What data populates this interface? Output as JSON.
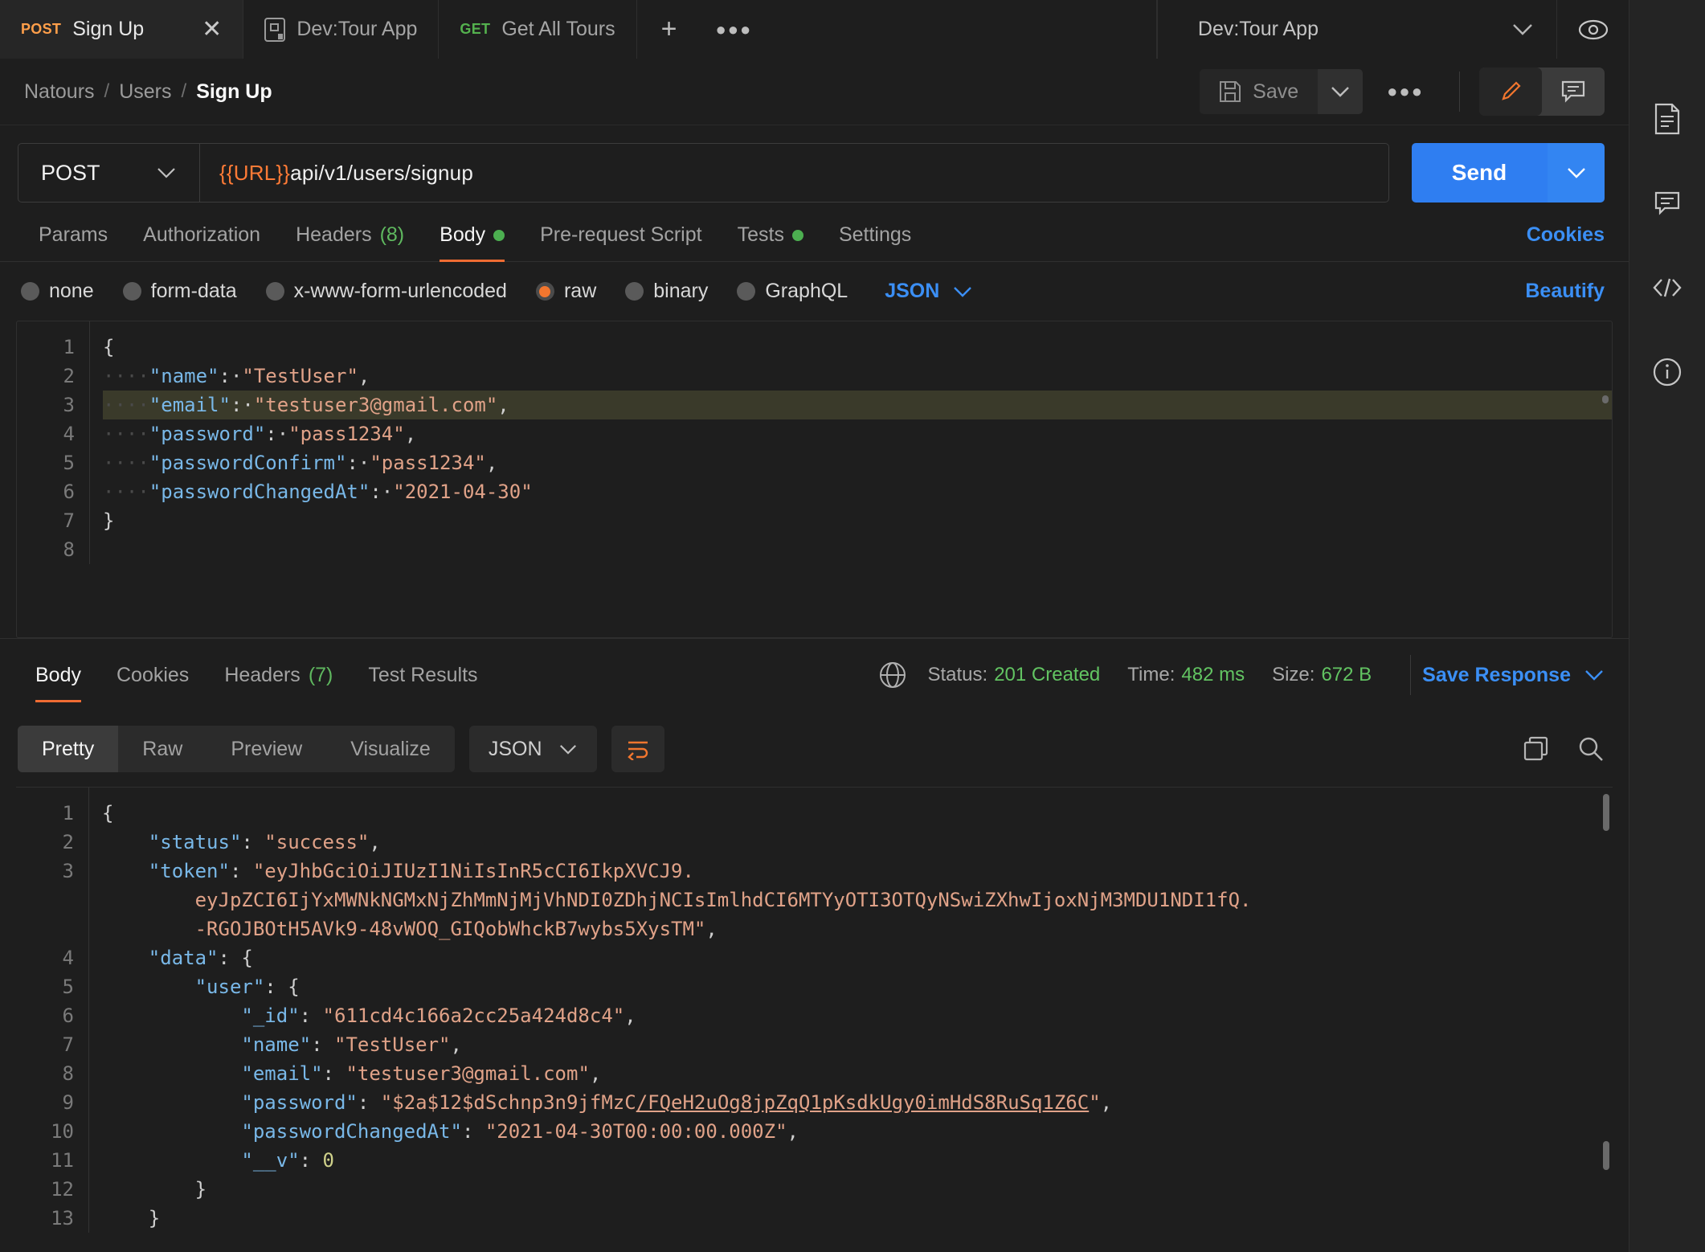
{
  "tabs": [
    {
      "verb": "POST",
      "verb_class": "post",
      "label": "Sign Up",
      "active": true,
      "close": "✕"
    },
    {
      "verb": "",
      "verb_class": "",
      "label": "Dev:Tour App",
      "active": false,
      "close": ""
    },
    {
      "verb": "GET",
      "verb_class": "get",
      "label": "Get All Tours",
      "active": false,
      "close": ""
    }
  ],
  "tabbar": {
    "new_tab": "+",
    "more": "●●●"
  },
  "environment": {
    "name": "Dev:Tour App",
    "chevron": "⌄",
    "eye_icon": "eye-icon"
  },
  "breadcrumb": {
    "collection": "Natours",
    "folder": "Users",
    "request": "Sign Up",
    "separator": "/"
  },
  "actions": {
    "save_label": "Save",
    "save_chevron": "⌄",
    "more_label": "●●●",
    "edit_icon": "pencil-icon",
    "comment_icon": "comment-icon"
  },
  "request": {
    "method": "POST",
    "method_chevron": "⌄",
    "url_variable": "{{URL}}",
    "url_path": "api/v1/users/signup",
    "send_label": "Send",
    "send_chevron": "⌄",
    "tabs": [
      {
        "label": "Params",
        "active": false,
        "count": "",
        "dot": false
      },
      {
        "label": "Authorization",
        "active": false,
        "count": "",
        "dot": false
      },
      {
        "label": "Headers",
        "active": false,
        "count": "(8)",
        "dot": false
      },
      {
        "label": "Body",
        "active": true,
        "count": "",
        "dot": true
      },
      {
        "label": "Pre-request Script",
        "active": false,
        "count": "",
        "dot": false
      },
      {
        "label": "Tests",
        "active": false,
        "count": "",
        "dot": true
      },
      {
        "label": "Settings",
        "active": false,
        "count": "",
        "dot": false
      }
    ],
    "cookies_link": "Cookies",
    "body_types": [
      {
        "label": "none",
        "selected": false
      },
      {
        "label": "form-data",
        "selected": false
      },
      {
        "label": "x-www-form-urlencoded",
        "selected": false
      },
      {
        "label": "raw",
        "selected": true
      },
      {
        "label": "binary",
        "selected": false
      },
      {
        "label": "GraphQL",
        "selected": false
      }
    ],
    "format": "JSON",
    "format_chevron": "⌄",
    "beautify_label": "Beautify",
    "body_lines": [
      {
        "num": "1",
        "highlight": false,
        "segments": [
          {
            "t": "{",
            "c": "p"
          }
        ]
      },
      {
        "num": "2",
        "highlight": false,
        "segments": [
          {
            "t": "····",
            "c": "ind"
          },
          {
            "t": "\"name\"",
            "c": "k"
          },
          {
            "t": ":·",
            "c": "p"
          },
          {
            "t": "\"TestUser\"",
            "c": "s"
          },
          {
            "t": ",",
            "c": "p"
          }
        ]
      },
      {
        "num": "3",
        "highlight": true,
        "segments": [
          {
            "t": "····",
            "c": "ind"
          },
          {
            "t": "\"email\"",
            "c": "k"
          },
          {
            "t": ":·",
            "c": "p"
          },
          {
            "t": "\"testuser3@gmail.com\"",
            "c": "s"
          },
          {
            "t": ",",
            "c": "p"
          }
        ]
      },
      {
        "num": "4",
        "highlight": false,
        "segments": [
          {
            "t": "····",
            "c": "ind"
          },
          {
            "t": "\"password\"",
            "c": "k"
          },
          {
            "t": ":·",
            "c": "p"
          },
          {
            "t": "\"pass1234\"",
            "c": "s"
          },
          {
            "t": ",",
            "c": "p"
          }
        ]
      },
      {
        "num": "5",
        "highlight": false,
        "segments": [
          {
            "t": "····",
            "c": "ind"
          },
          {
            "t": "\"passwordConfirm\"",
            "c": "k"
          },
          {
            "t": ":·",
            "c": "p"
          },
          {
            "t": "\"pass1234\"",
            "c": "s"
          },
          {
            "t": ",",
            "c": "p"
          }
        ]
      },
      {
        "num": "6",
        "highlight": false,
        "segments": [
          {
            "t": "····",
            "c": "ind"
          },
          {
            "t": "\"passwordChangedAt\"",
            "c": "k"
          },
          {
            "t": ":·",
            "c": "p"
          },
          {
            "t": "\"2021-04-30\"",
            "c": "s"
          }
        ]
      },
      {
        "num": "7",
        "highlight": false,
        "segments": [
          {
            "t": "}",
            "c": "p"
          }
        ]
      },
      {
        "num": "8",
        "highlight": false,
        "segments": []
      }
    ]
  },
  "response": {
    "tabs": [
      {
        "label": "Body",
        "active": true,
        "count": ""
      },
      {
        "label": "Cookies",
        "active": false,
        "count": ""
      },
      {
        "label": "Headers",
        "active": false,
        "count": "(7)"
      },
      {
        "label": "Test Results",
        "active": false,
        "count": ""
      }
    ],
    "status_label": "Status:",
    "status_value": "201 Created",
    "time_label": "Time:",
    "time_value": "482 ms",
    "size_label": "Size:",
    "size_value": "672 B",
    "save_response": "Save Response",
    "save_response_chevron": "⌄",
    "view_modes": [
      {
        "label": "Pretty",
        "active": true
      },
      {
        "label": "Raw",
        "active": false
      },
      {
        "label": "Preview",
        "active": false
      },
      {
        "label": "Visualize",
        "active": false
      }
    ],
    "format": "JSON",
    "format_chevron": "⌄",
    "wrap_icon": "word-wrap-icon",
    "copy_icon": "copy-icon",
    "search_icon": "search-icon",
    "body_lines": [
      {
        "num": "1",
        "segments": [
          {
            "t": "{",
            "c": "p"
          }
        ]
      },
      {
        "num": "2",
        "segments": [
          {
            "t": "    ",
            "c": "p"
          },
          {
            "t": "\"status\"",
            "c": "k"
          },
          {
            "t": ": ",
            "c": "p"
          },
          {
            "t": "\"success\"",
            "c": "s"
          },
          {
            "t": ",",
            "c": "p"
          }
        ]
      },
      {
        "num": "3",
        "segments": [
          {
            "t": "    ",
            "c": "p"
          },
          {
            "t": "\"token\"",
            "c": "k"
          },
          {
            "t": ": ",
            "c": "p"
          },
          {
            "t": "\"eyJhbGciOiJIUzI1NiIsInR5cCI6IkpXVCJ9.",
            "c": "s"
          }
        ]
      },
      {
        "num": "",
        "segments": [
          {
            "t": "        eyJpZCI6IjYxMWNkNGMxNjZhMmNjMjVhNDI0ZDhjNCIsImlhdCI6MTYyOTI3OTQyNSwiZXhwIjoxNjM3MDU1NDI1fQ.",
            "c": "s"
          }
        ]
      },
      {
        "num": "",
        "segments": [
          {
            "t": "        -RGOJBOtH5AVk9-48vWOQ_GIQobWhckB7wybs5XysTM\"",
            "c": "s"
          },
          {
            "t": ",",
            "c": "p"
          }
        ]
      },
      {
        "num": "4",
        "segments": [
          {
            "t": "    ",
            "c": "p"
          },
          {
            "t": "\"data\"",
            "c": "k"
          },
          {
            "t": ": ",
            "c": "p"
          },
          {
            "t": "{",
            "c": "p"
          }
        ]
      },
      {
        "num": "5",
        "segments": [
          {
            "t": "        ",
            "c": "p"
          },
          {
            "t": "\"user\"",
            "c": "k"
          },
          {
            "t": ": ",
            "c": "p"
          },
          {
            "t": "{",
            "c": "p"
          }
        ]
      },
      {
        "num": "6",
        "segments": [
          {
            "t": "            ",
            "c": "p"
          },
          {
            "t": "\"_id\"",
            "c": "k"
          },
          {
            "t": ": ",
            "c": "p"
          },
          {
            "t": "\"611cd4c166a2cc25a424d8c4\"",
            "c": "s"
          },
          {
            "t": ",",
            "c": "p"
          }
        ]
      },
      {
        "num": "7",
        "segments": [
          {
            "t": "            ",
            "c": "p"
          },
          {
            "t": "\"name\"",
            "c": "k"
          },
          {
            "t": ": ",
            "c": "p"
          },
          {
            "t": "\"TestUser\"",
            "c": "s"
          },
          {
            "t": ",",
            "c": "p"
          }
        ]
      },
      {
        "num": "8",
        "segments": [
          {
            "t": "            ",
            "c": "p"
          },
          {
            "t": "\"email\"",
            "c": "k"
          },
          {
            "t": ": ",
            "c": "p"
          },
          {
            "t": "\"testuser3@gmail.com\"",
            "c": "s"
          },
          {
            "t": ",",
            "c": "p"
          }
        ]
      },
      {
        "num": "9",
        "segments": [
          {
            "t": "            ",
            "c": "p"
          },
          {
            "t": "\"password\"",
            "c": "k"
          },
          {
            "t": ": ",
            "c": "p"
          },
          {
            "t": "\"$2a$12$dSchnp3n9jfMzC",
            "c": "s"
          },
          {
            "t": "/FQeH2uOg8jpZqQ1pKsdkUgy0imHdS8RuSq1Z6C",
            "c": "s ul"
          },
          {
            "t": "\"",
            "c": "s"
          },
          {
            "t": ",",
            "c": "p"
          }
        ]
      },
      {
        "num": "10",
        "segments": [
          {
            "t": "            ",
            "c": "p"
          },
          {
            "t": "\"passwordChangedAt\"",
            "c": "k"
          },
          {
            "t": ": ",
            "c": "p"
          },
          {
            "t": "\"2021-04-30T00:00:00.000Z\"",
            "c": "s"
          },
          {
            "t": ",",
            "c": "p"
          }
        ]
      },
      {
        "num": "11",
        "segments": [
          {
            "t": "            ",
            "c": "p"
          },
          {
            "t": "\"__v\"",
            "c": "k"
          },
          {
            "t": ": ",
            "c": "p"
          },
          {
            "t": "0",
            "c": "n"
          }
        ]
      },
      {
        "num": "12",
        "segments": [
          {
            "t": "        ",
            "c": "p"
          },
          {
            "t": "}",
            "c": "p"
          }
        ]
      },
      {
        "num": "13",
        "segments": [
          {
            "t": "    ",
            "c": "p"
          },
          {
            "t": "}",
            "c": "p"
          }
        ]
      }
    ]
  },
  "rail": [
    {
      "icon": "documentation-icon"
    },
    {
      "icon": "comment-icon"
    },
    {
      "icon": "code-icon"
    },
    {
      "icon": "info-icon"
    }
  ],
  "colors": {
    "accent_orange": "#ef6c33",
    "link_blue": "#3b8ff5",
    "success_green": "#62c462",
    "send_blue": "#2f7ef1"
  }
}
